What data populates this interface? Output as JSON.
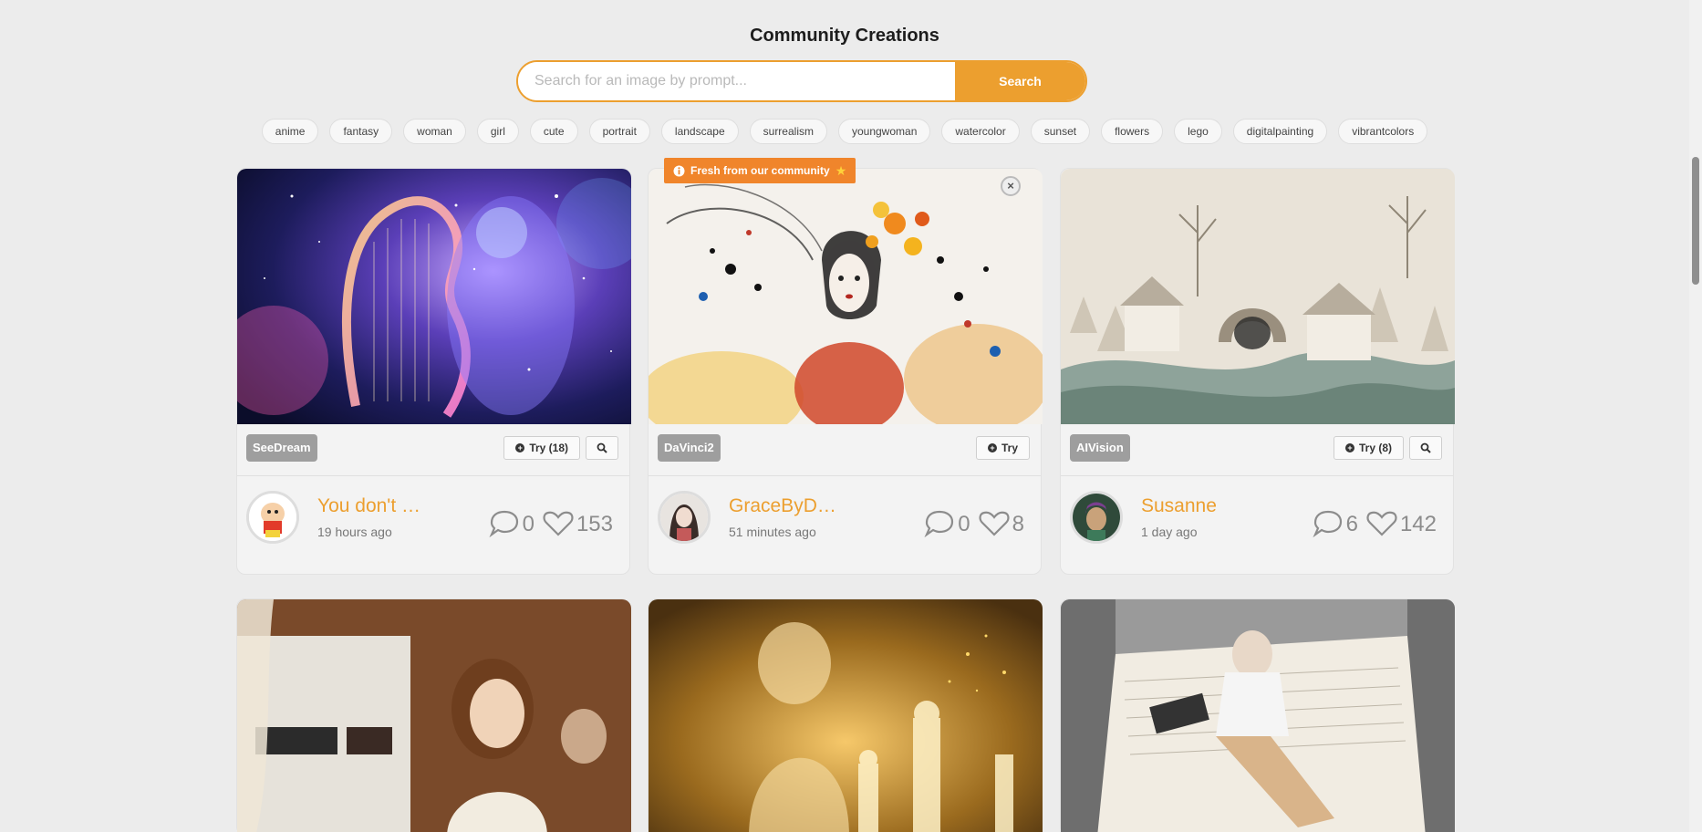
{
  "page": {
    "title": "Community Creations"
  },
  "search": {
    "placeholder": "Search for an image by prompt...",
    "value": "",
    "button_label": "Search"
  },
  "tags": [
    "anime",
    "fantasy",
    "woman",
    "girl",
    "cute",
    "portrait",
    "landscape",
    "surrealism",
    "youngwoman",
    "watercolor",
    "sunset",
    "flowers",
    "lego",
    "digitalpainting",
    "vibrantcolors"
  ],
  "fresh_banner": {
    "label": "Fresh from our community",
    "close_label": "×"
  },
  "cards": [
    {
      "model": "SeeDream",
      "try_label": "Try (18)",
      "has_search": true,
      "username": "You don't …",
      "time": "19 hours ago",
      "comments": "0",
      "likes": "153",
      "image_desc": "harp-cosmic-woman"
    },
    {
      "model": "DaVinci2",
      "try_label": "Try",
      "has_search": false,
      "username": "GraceByD…",
      "time": "51 minutes ago",
      "comments": "0",
      "likes": "8",
      "image_desc": "woman-with-flowers-ink"
    },
    {
      "model": "AIVision",
      "try_label": "Try (8)",
      "has_search": true,
      "username": "Susanne",
      "time": "1 day ago",
      "comments": "6",
      "likes": "142",
      "image_desc": "winter-village-paper"
    }
  ],
  "colors": {
    "accent": "#ec9f2f",
    "fresh_badge": "#f0852b",
    "model_badge": "#9e9e9e",
    "background": "#ececec"
  }
}
